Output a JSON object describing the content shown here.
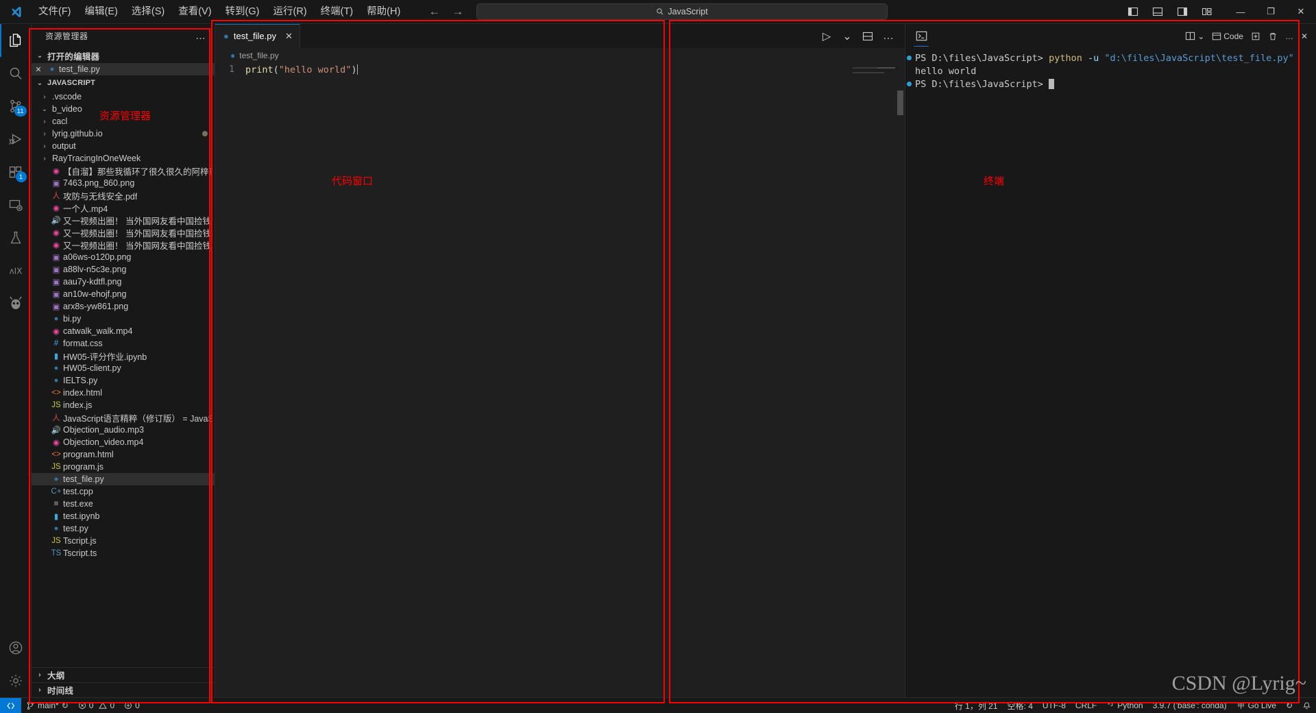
{
  "window": {
    "menu": [
      {
        "label": "文件(F)",
        "name": "menu-file"
      },
      {
        "label": "编辑(E)",
        "name": "menu-edit"
      },
      {
        "label": "选择(S)",
        "name": "menu-selection"
      },
      {
        "label": "查看(V)",
        "name": "menu-view"
      },
      {
        "label": "转到(G)",
        "name": "menu-go"
      },
      {
        "label": "运行(R)",
        "name": "menu-run"
      },
      {
        "label": "终端(T)",
        "name": "menu-terminal"
      },
      {
        "label": "帮助(H)",
        "name": "menu-help"
      }
    ],
    "search_value": "JavaScript",
    "back_arrow": "←",
    "forward_arrow": "→",
    "minimize": "—",
    "maximize": "❐",
    "close": "✕"
  },
  "activitybar": {
    "items": [
      {
        "name": "explorer",
        "badge": ""
      },
      {
        "name": "search",
        "badge": ""
      },
      {
        "name": "source-control",
        "badge": "11"
      },
      {
        "name": "run-and-debug",
        "badge": ""
      },
      {
        "name": "extensions",
        "badge": "1"
      },
      {
        "name": "remote-explorer",
        "badge": ""
      },
      {
        "name": "testing",
        "badge": ""
      },
      {
        "name": "ai-tool",
        "badge": ""
      },
      {
        "name": "bug-bot",
        "badge": ""
      }
    ]
  },
  "sidebar": {
    "title": "资源管理器",
    "more": "…",
    "open_editors": {
      "label": "打开的编辑器",
      "chevron": "⌄",
      "items": [
        {
          "close": "✕",
          "icon": "python",
          "name": "test_file.py",
          "selected": true
        }
      ]
    },
    "workspace": {
      "label": "JAVASCRIPT",
      "chevron": "⌄"
    },
    "tree": [
      {
        "kind": "folder",
        "chevron": "›",
        "name": ".vscode",
        "indent": 1
      },
      {
        "kind": "folder",
        "chevron": "⌄",
        "name": "b_video",
        "indent": 1
      },
      {
        "kind": "folder",
        "chevron": "›",
        "name": "cacl",
        "indent": 1
      },
      {
        "kind": "folder",
        "chevron": "›",
        "name": "lyrig.github.io",
        "indent": 1,
        "modified": true
      },
      {
        "kind": "folder",
        "chevron": "›",
        "name": "output",
        "indent": 1
      },
      {
        "kind": "folder",
        "chevron": "›",
        "name": "RayTracingInOneWeek",
        "indent": 1
      },
      {
        "kind": "mp4",
        "name": "【自溜】那些我循环了很久很久的阿梓歌_video.m...",
        "indent": 1
      },
      {
        "kind": "img",
        "name": "7463.png_860.png",
        "indent": 1
      },
      {
        "kind": "pdf",
        "name": "攻防与无线安全.pdf",
        "indent": 1
      },
      {
        "kind": "mp4",
        "name": "一个人.mp4",
        "indent": 1
      },
      {
        "kind": "mp3",
        "name": "又一视频出圈！ 当外国网友看中国捡钱梗视频，…",
        "indent": 1
      },
      {
        "kind": "mp4",
        "name": "又一视频出圈！ 当外国网友看中国捡钱梗视频，…",
        "indent": 1
      },
      {
        "kind": "mp4",
        "name": "又一视频出圈！ 当外国网友看中国捡钱梗视频，…",
        "indent": 1
      },
      {
        "kind": "img",
        "name": "a06ws-o120p.png",
        "indent": 1
      },
      {
        "kind": "img",
        "name": "a88lv-n5c3e.png",
        "indent": 1
      },
      {
        "kind": "img",
        "name": "aau7y-kdtfl.png",
        "indent": 1
      },
      {
        "kind": "img",
        "name": "an10w-ehojf.png",
        "indent": 1
      },
      {
        "kind": "img",
        "name": "arx8s-yw861.png",
        "indent": 1
      },
      {
        "kind": "py",
        "name": "bi.py",
        "indent": 1
      },
      {
        "kind": "mp4",
        "name": "catwalk_walk.mp4",
        "indent": 1
      },
      {
        "kind": "css",
        "name": "format.css",
        "indent": 1
      },
      {
        "kind": "ipynb",
        "name": "HW05-评分作业.ipynb",
        "indent": 1
      },
      {
        "kind": "py",
        "name": "HW05-client.py",
        "indent": 1
      },
      {
        "kind": "py",
        "name": "IELTS.py",
        "indent": 1
      },
      {
        "kind": "html",
        "name": "index.html",
        "indent": 1
      },
      {
        "kind": "js",
        "name": "index.js",
        "indent": 1
      },
      {
        "kind": "pdf",
        "name": "JavaScript语言精粹（修订版） = JavaScriptThe G...",
        "indent": 1
      },
      {
        "kind": "mp3",
        "name": "Objection_audio.mp3",
        "indent": 1
      },
      {
        "kind": "mp4",
        "name": "Objection_video.mp4",
        "indent": 1
      },
      {
        "kind": "html",
        "name": "program.html",
        "indent": 1
      },
      {
        "kind": "js",
        "name": "program.js",
        "indent": 1
      },
      {
        "kind": "py",
        "name": "test_file.py",
        "indent": 1,
        "selected": true
      },
      {
        "kind": "cpp",
        "name": "test.cpp",
        "indent": 1
      },
      {
        "kind": "exe",
        "name": "test.exe",
        "indent": 1
      },
      {
        "kind": "ipynb",
        "name": "test.ipynb",
        "indent": 1
      },
      {
        "kind": "py",
        "name": "test.py",
        "indent": 1
      },
      {
        "kind": "js",
        "name": "Tscript.js",
        "indent": 1
      },
      {
        "kind": "ts",
        "name": "Tscript.ts",
        "indent": 1
      }
    ],
    "bottom_sections": [
      {
        "label": "大纲",
        "chevron": "›",
        "name": "outline"
      },
      {
        "label": "时间线",
        "chevron": "›",
        "name": "timeline"
      }
    ]
  },
  "editor": {
    "tab": {
      "label": "test_file.py",
      "close": "✕"
    },
    "actions": {
      "run": "▷",
      "run_chevron": "⌄",
      "split": "▭",
      "more": "…"
    },
    "breadcrumb": "test_file.py",
    "line_number": "1",
    "code": {
      "fn": "print",
      "paren_open": "(",
      "string": "\"hello world\"",
      "paren_close": ")"
    }
  },
  "terminal": {
    "tab_icon": "terminal-icon",
    "actions": {
      "split": "▭",
      "chevron": "⌄",
      "label": "Code",
      "new": "▭",
      "trash": "🗑",
      "more": "…",
      "close": "✕"
    },
    "lines": [
      {
        "segments": [
          {
            "t": "PS D:\\files\\JavaScript> ",
            "cls": "t-ps"
          },
          {
            "t": "python ",
            "cls": "t-cmd"
          },
          {
            "t": "-u ",
            "cls": "t-flag"
          },
          {
            "t": "\"d:\\files\\JavaScript\\test_file.py\"",
            "cls": "t-path"
          }
        ],
        "bullet": true
      },
      {
        "segments": [
          {
            "t": "hello world",
            "cls": "t-ps"
          }
        ],
        "bullet": false
      },
      {
        "segments": [
          {
            "t": "PS D:\\files\\JavaScript> ",
            "cls": "t-ps"
          }
        ],
        "bullet": true,
        "cursor": true
      }
    ]
  },
  "statusbar": {
    "remote": "><",
    "branch": "main*",
    "sync": "↻",
    "errors": "0",
    "warnings": "0",
    "ports": "0",
    "position": "行 1，列 21",
    "spaces": "空格: 4",
    "encoding": "UTF-8",
    "eol": "CRLF",
    "language": "Python",
    "interpreter": "3.9.7 ('base': conda)",
    "golive": "Go Live",
    "refresh": "↻",
    "bell": "🔔"
  },
  "annotations": {
    "explorer_label": "资源管理器",
    "editor_label": "代码窗口",
    "terminal_label": "终端"
  },
  "watermark": "CSDN @Lyrig~",
  "colors": {
    "accent": "#0078d4",
    "annotation": "#ff0000",
    "bg": "#1f1f1f",
    "chrome": "#181818"
  }
}
